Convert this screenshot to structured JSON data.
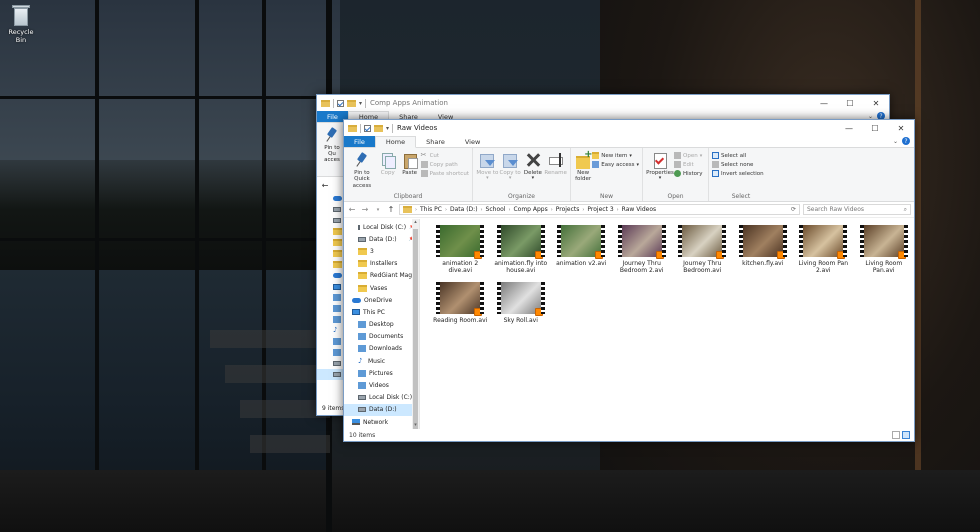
{
  "desktop": {
    "recycle_bin_label": "Recycle Bin"
  },
  "back_window": {
    "title": "Comp Apps Animation",
    "tabs": [
      "File",
      "Home",
      "Share",
      "View"
    ],
    "pin_label_1": "Pin to Qu",
    "pin_label_2": "acces",
    "status": "9 items"
  },
  "front_window": {
    "title": "Raw Videos",
    "tabs": {
      "file": "File",
      "home": "Home",
      "share": "Share",
      "view": "View"
    },
    "ribbon": {
      "clipboard": {
        "label": "Clipboard",
        "pin_quick_access": "Pin to Quick access",
        "copy": "Copy",
        "paste": "Paste",
        "cut": "Cut",
        "copy_path": "Copy path",
        "paste_shortcut": "Paste shortcut"
      },
      "organize": {
        "label": "Organize",
        "move_to": "Move to",
        "copy_to": "Copy to",
        "delete": "Delete",
        "rename": "Rename"
      },
      "new": {
        "label": "New",
        "new_folder": "New folder",
        "new_item": "New item",
        "easy_access": "Easy access"
      },
      "open": {
        "label": "Open",
        "properties": "Properties",
        "open": "Open",
        "edit": "Edit",
        "history": "History"
      },
      "select": {
        "label": "Select",
        "select_all": "Select all",
        "select_none": "Select none",
        "invert_selection": "Invert selection"
      }
    },
    "address": {
      "crumbs": [
        "This PC",
        "Data (D:)",
        "School",
        "Comp Apps",
        "Projects",
        "Project 3",
        "Raw Videos"
      ],
      "search_placeholder": "Search Raw Videos"
    },
    "nav_pane": {
      "items": [
        {
          "label": "Local Disk (C:)",
          "icon": "drive-icon",
          "pinned": true
        },
        {
          "label": "Data (D:)",
          "icon": "drive-icon",
          "pinned": true
        },
        {
          "label": "3",
          "icon": "folder-icon"
        },
        {
          "label": "Installers",
          "icon": "folder-icon"
        },
        {
          "label": "RedGiant Magic",
          "icon": "folder-icon"
        },
        {
          "label": "Vases",
          "icon": "folder-icon"
        },
        {
          "label": "OneDrive",
          "icon": "onedrive-icon",
          "top": true
        },
        {
          "label": "This PC",
          "icon": "pc-icon",
          "top": true
        },
        {
          "label": "Desktop",
          "icon": "desktop-icon"
        },
        {
          "label": "Documents",
          "icon": "documents-icon"
        },
        {
          "label": "Downloads",
          "icon": "downloads-icon"
        },
        {
          "label": "Music",
          "icon": "music-icon"
        },
        {
          "label": "Pictures",
          "icon": "pictures-icon"
        },
        {
          "label": "Videos",
          "icon": "videos-icon"
        },
        {
          "label": "Local Disk (C:)",
          "icon": "drive-icon"
        },
        {
          "label": "Data (D:)",
          "icon": "drive-icon",
          "selected": true
        },
        {
          "label": "Network",
          "icon": "network-icon",
          "top": true
        }
      ]
    },
    "files": [
      {
        "name": "animation 2 dive.avi",
        "tone": [
          "#3a6a2e",
          "#6f8f4a"
        ]
      },
      {
        "name": "animation.fly into house.avi",
        "tone": [
          "#2f4a2a",
          "#7a9a66"
        ]
      },
      {
        "name": "animation v2.avi",
        "tone": [
          "#44703a",
          "#9aa97a"
        ]
      },
      {
        "name": "Journey Thru Bedroom 2.avi",
        "tone": [
          "#5b3a56",
          "#b9a89a"
        ]
      },
      {
        "name": "Journey Thru Bedroom.avi",
        "tone": [
          "#6b5a40",
          "#d8d2c2"
        ]
      },
      {
        "name": "kitchen.fly.avi",
        "tone": [
          "#4a3222",
          "#a08060"
        ]
      },
      {
        "name": "Living Room Pan 2.avi",
        "tone": [
          "#6a4a2a",
          "#d6c2a0"
        ]
      },
      {
        "name": "Living Room Pan.avi",
        "tone": [
          "#5a3e26",
          "#c8b494"
        ]
      },
      {
        "name": "Reading Room.avi",
        "tone": [
          "#4a3526",
          "#b09070"
        ]
      },
      {
        "name": "Sky Roll.avi",
        "tone": [
          "#7a7a7a",
          "#e0e0e0"
        ]
      }
    ],
    "status": "10 items"
  }
}
